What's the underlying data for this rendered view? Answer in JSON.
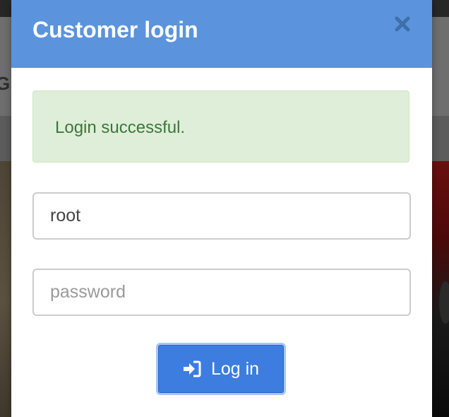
{
  "background": {
    "brand_fragment": "G"
  },
  "modal": {
    "title": "Customer login",
    "close_icon": "close-icon",
    "alert": {
      "text": "Login successful.",
      "type": "success",
      "color": "#3c763d"
    },
    "username": {
      "value": "root"
    },
    "password": {
      "value": "",
      "placeholder": "password"
    },
    "login_button": {
      "label": "Log in",
      "icon": "sign-in-icon"
    },
    "colors": {
      "header": "#5b93dc",
      "button": "#3d7ddf",
      "alert_bg": "#dfeed8"
    }
  }
}
